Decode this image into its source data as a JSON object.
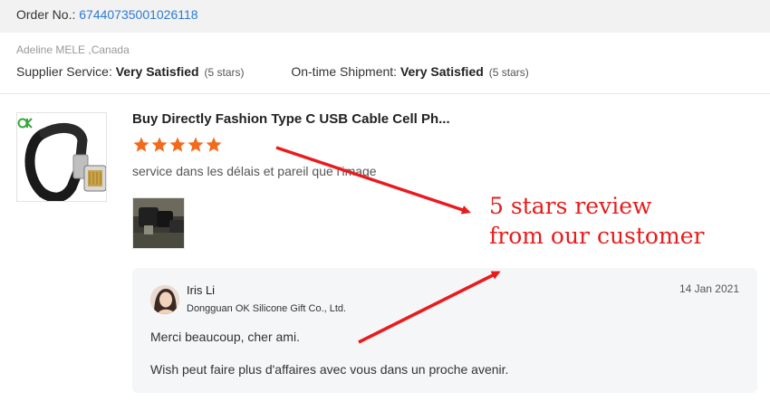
{
  "order": {
    "label": "Order No.: ",
    "number": "67440735001026118"
  },
  "buyer": {
    "name": "Adeline MELE ,Canada",
    "supplier_service_label": "Supplier Service: ",
    "supplier_service_value": "Very Satisfied",
    "supplier_service_stars": "(5 stars)",
    "shipment_label": "On-time Shipment: ",
    "shipment_value": "Very Satisfied",
    "shipment_stars": "(5 stars)"
  },
  "product": {
    "thumb_icon": "usb-cable-bracelet-image",
    "logo_text": "OK",
    "title": "Buy Directly Fashion Type C USB Cable Cell Ph...",
    "rating": 5,
    "rating_max": 5,
    "star_color": "#f26b1d",
    "review_text": "service dans les délais et pareil que l'image",
    "review_photo_icon": "customer-photo-thumbnail"
  },
  "reply": {
    "name": "Iris Li",
    "company": "Dongguan OK Silicone Gift Co., Ltd.",
    "date": "14 Jan 2021",
    "line1": "Merci beaucoup, cher ami.",
    "line2": "Wish peut faire plus d'affaires avec vous dans un proche avenir."
  },
  "annotation": {
    "line1": "5 stars review",
    "line2": "from our customer",
    "color": "#e81c1c"
  },
  "colors": {
    "link": "#2e7bd3",
    "order_bar_bg": "#f2f2f2",
    "reply_bg": "#f5f6f8"
  }
}
